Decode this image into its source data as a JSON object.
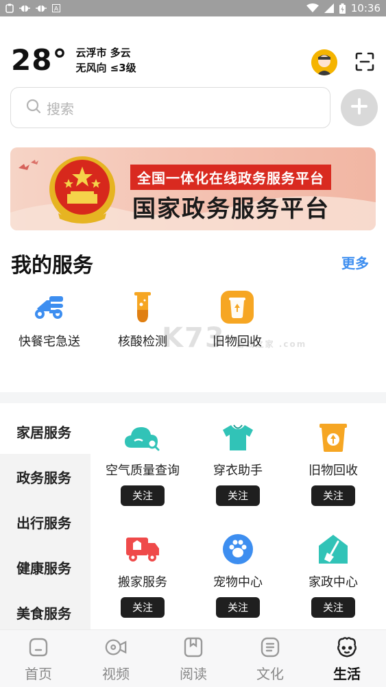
{
  "status_bar": {
    "time": "10:36",
    "left_icons": [
      "clipboard-icon",
      "bug-icon",
      "bug-icon",
      "font-icon"
    ],
    "right_icons": [
      "wifi-icon",
      "signal-icon",
      "battery-icon"
    ]
  },
  "weather": {
    "temperature": "28°",
    "line1": "云浮市 多云",
    "line2": "无风向 ≤3级"
  },
  "search": {
    "placeholder": "搜索"
  },
  "banner": {
    "tagline": "全国一体化在线政务服务平台",
    "title": "国家政务服务平台"
  },
  "my_services": {
    "title": "我的服务",
    "more": "更多",
    "items": [
      {
        "label": "快餐宅急送",
        "icon": "scooter-icon",
        "color": "#3d8ef0"
      },
      {
        "label": "核酸检测",
        "icon": "flask-icon",
        "color": "#f6a623"
      },
      {
        "label": "旧物回收",
        "icon": "recycle-icon",
        "color": "#f6a623"
      }
    ]
  },
  "watermark": {
    "text": "K73",
    "sub": "游戏之家 .com"
  },
  "categories": [
    {
      "label": "家居服务",
      "active": true
    },
    {
      "label": "政务服务",
      "active": false
    },
    {
      "label": "出行服务",
      "active": false
    },
    {
      "label": "健康服务",
      "active": false
    },
    {
      "label": "美食服务",
      "active": false
    }
  ],
  "grid": [
    {
      "label": "空气质量查询",
      "icon": "cloud-search-icon",
      "color": "#31c3b7",
      "action": "关注"
    },
    {
      "label": "穿衣助手",
      "icon": "tshirt-icon",
      "color": "#31c3b7",
      "action": "关注"
    },
    {
      "label": "旧物回收",
      "icon": "recycle-bin-icon",
      "color": "#f6a623",
      "action": "关注"
    },
    {
      "label": "搬家服务",
      "icon": "truck-icon",
      "color": "#ef4a4a",
      "action": "关注"
    },
    {
      "label": "宠物中心",
      "icon": "paw-icon",
      "color": "#3d8ef0",
      "action": "关注"
    },
    {
      "label": "家政中心",
      "icon": "house-broom-icon",
      "color": "#31c3b7",
      "action": "关注"
    }
  ],
  "bottom_nav": [
    {
      "label": "首页",
      "icon": "home-icon",
      "active": false
    },
    {
      "label": "视频",
      "icon": "video-icon",
      "active": false
    },
    {
      "label": "阅读",
      "icon": "book-icon",
      "active": false
    },
    {
      "label": "文化",
      "icon": "culture-icon",
      "active": false
    },
    {
      "label": "生活",
      "icon": "life-icon",
      "active": true
    }
  ]
}
